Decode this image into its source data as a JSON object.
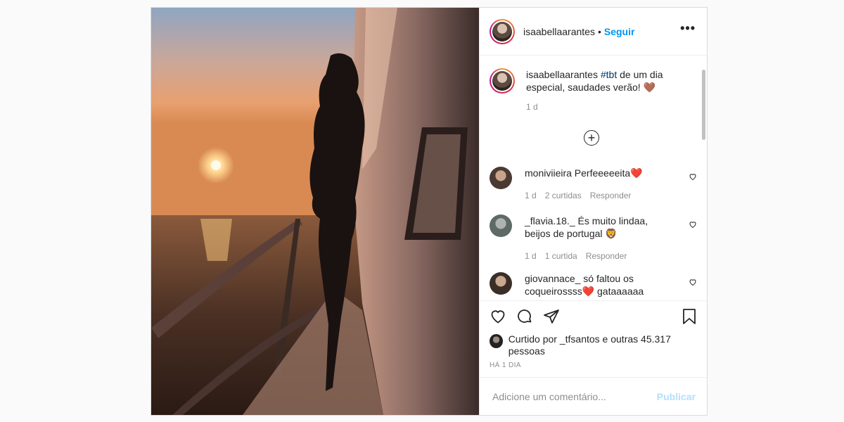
{
  "header": {
    "username": "isaabellaarantes",
    "dot": "•",
    "follow_label": "Seguir",
    "more_label": "•••"
  },
  "caption": {
    "username": "isaabellaarantes",
    "hashtag": "#tbt",
    "text": " de um dia especial, saudades verão! 🤎",
    "time": "1 d"
  },
  "load_more_label": "+",
  "comments": [
    {
      "username": "moniviieira",
      "text": " Perfeeeeeita❤️",
      "time": "1 d",
      "likes": "2 curtidas",
      "reply": "Responder"
    },
    {
      "username": "_flavia.18._",
      "text": " És muito lindaa, beijos de portugal 🦁",
      "time": "1 d",
      "likes": "1 curtida",
      "reply": "Responder"
    },
    {
      "username": "giovannace_",
      "text": " só faltou os coqueirossss❤️ gataaaaaa",
      "time": "",
      "likes": "",
      "reply": ""
    }
  ],
  "likes": {
    "prefix": "Curtido por ",
    "user": "_tfsantos",
    "middle": " e outras ",
    "count": "45.317 pessoas"
  },
  "timestamp": "HÁ 1 DIA",
  "add_comment": {
    "placeholder": "Adicione um comentário...",
    "publish_label": "Publicar"
  },
  "colors": {
    "accent": "#0095f6",
    "publish_disabled": "#b2dffc",
    "muted": "#8e8e8e"
  }
}
